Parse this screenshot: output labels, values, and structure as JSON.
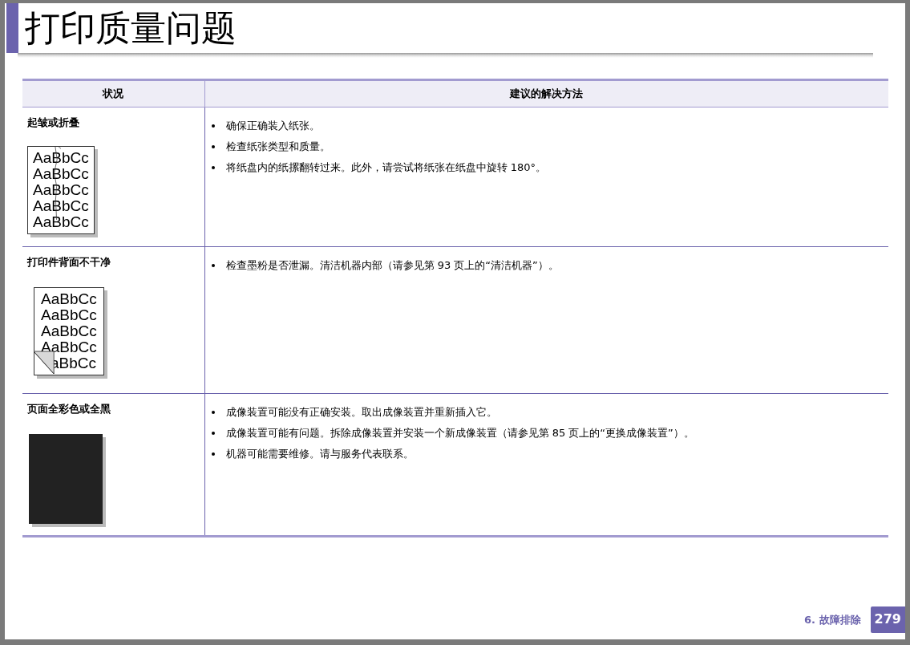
{
  "title": "打印质量问题",
  "table": {
    "columns": [
      "状况",
      "建议的解决方法"
    ],
    "rows": [
      {
        "condition": "起皱或折叠",
        "illustration": {
          "kind": "wrinkled",
          "lines": [
            "AaBbCc",
            "AaBbCc",
            "AaBbCc",
            "AaBbCc",
            "AaBbCc"
          ]
        },
        "solutions": [
          "确保正确装入纸张。",
          "检查纸张类型和质量。",
          "将纸盘内的纸摞翻转过来。此外，请尝试将纸张在纸盘中旋转 180°。"
        ]
      },
      {
        "condition": "打印件背面不干净",
        "illustration": {
          "kind": "dirty-back",
          "lines": [
            "AaBbCc",
            "AaBbCc",
            "AaBbCc",
            "AaBbCc",
            "aBbCc"
          ]
        },
        "solutions": [
          "检查墨粉是否泄漏。清洁机器内部（请参见第 93 页上的“清洁机器”）。"
        ]
      },
      {
        "condition": "页面全彩色或全黑",
        "illustration": {
          "kind": "solid-black"
        },
        "solutions": [
          "成像装置可能没有正确安装。取出成像装置并重新插入它。",
          "成像装置可能有问题。拆除成像装置并安装一个新成像装置（请参见第 85 页上的“更换成像装置”）。",
          "机器可能需要维修。请与服务代表联系。"
        ]
      }
    ]
  },
  "footer": {
    "chapter": "6.  故障排除",
    "page": "279"
  }
}
